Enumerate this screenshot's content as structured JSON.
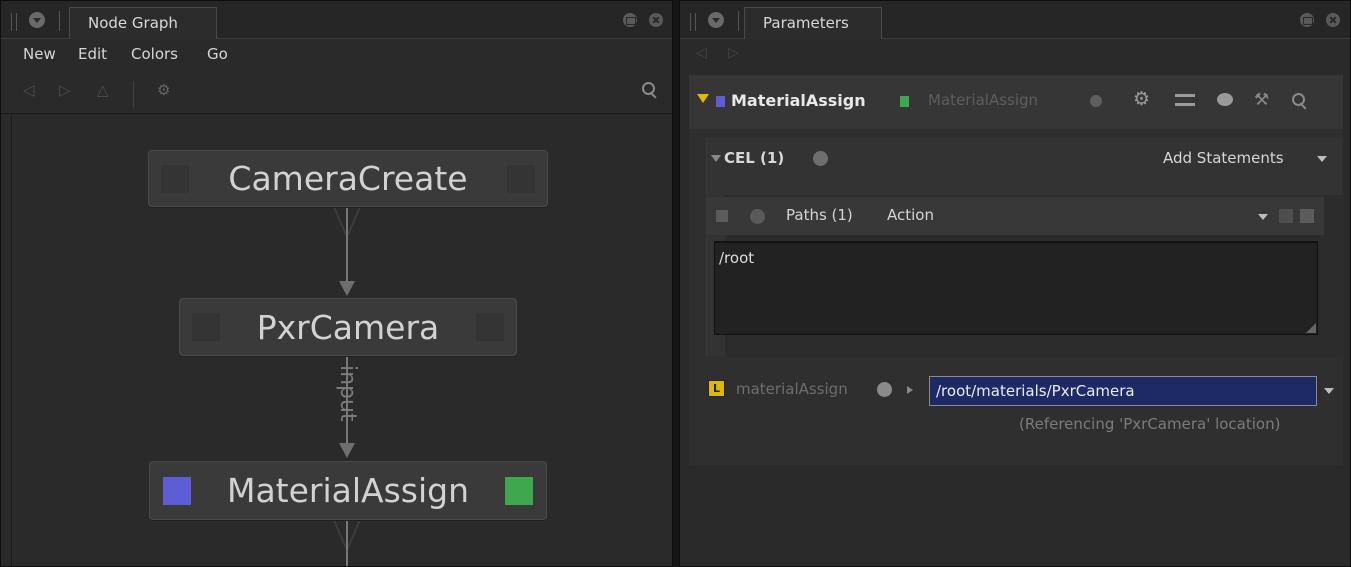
{
  "node_graph_panel": {
    "tab_label": "Node Graph",
    "menu": [
      "New",
      "Edit",
      "Colors",
      "Go"
    ],
    "nodes": [
      {
        "name": "CameraCreate"
      },
      {
        "name": "PxrCamera"
      },
      {
        "name": "MaterialAssign"
      }
    ],
    "edge_label": "input"
  },
  "parameters_panel": {
    "tab_label": "Parameters",
    "node_name": "MaterialAssign",
    "node_type": "MaterialAssign",
    "cel": {
      "label": "CEL (1)",
      "add_statements": "Add Statements",
      "statement": {
        "paths_label": "Paths (1)",
        "action_label": "Action",
        "value": "/root"
      }
    },
    "material_assign": {
      "badge": "L",
      "label": "materialAssign",
      "value": "/root/materials/PxrCamera",
      "note": "(Referencing 'PxrCamera' location)"
    }
  },
  "colors": {
    "accent_blue": "#5d5dd6",
    "accent_green": "#3fa84f",
    "triangle_yellow": "#e5b800",
    "field_bg": "#1e2a66"
  }
}
